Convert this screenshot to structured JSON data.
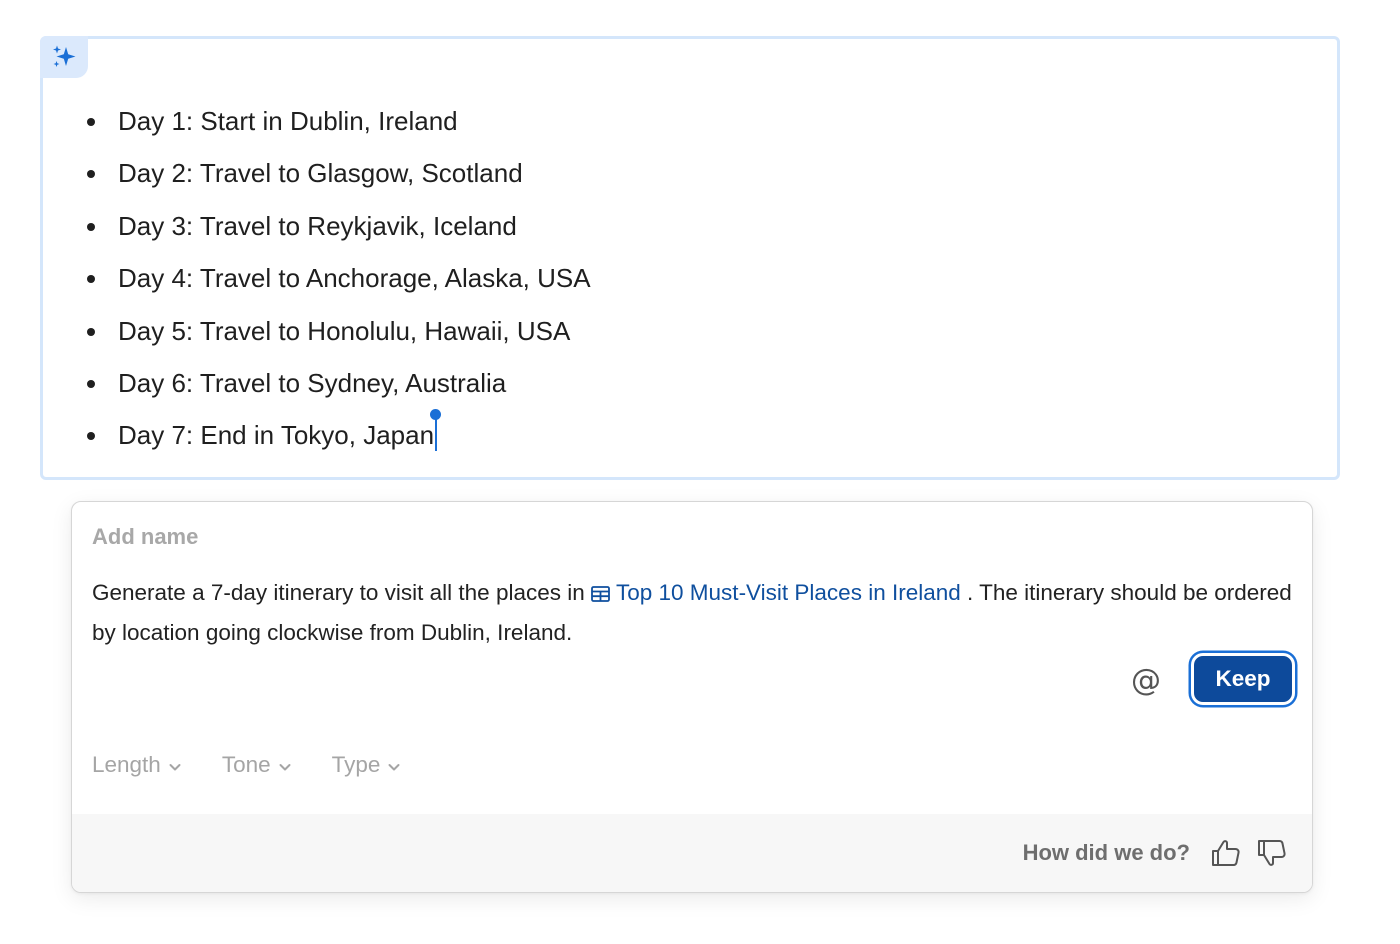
{
  "ai_block": {
    "icon": "sparkle-icon",
    "accent": "#1a6fd6",
    "items": [
      "Day 1: Start in Dublin, Ireland",
      "Day 2: Travel to Glasgow, Scotland",
      "Day 3: Travel to Reykjavik, Iceland",
      "Day 4: Travel to Anchorage, Alaska, USA",
      "Day 5: Travel to Honolulu, Hawaii, USA",
      "Day 6: Travel to Sydney, Australia",
      "Day 7: End in Tokyo, Japan"
    ]
  },
  "prompt": {
    "name_placeholder": "Add name",
    "text_before": "Generate a 7-day itinerary to visit all the places in ",
    "link_icon": "table-icon",
    "link_text": "Top 10 Must-Visit Places in Ireland",
    "text_after": " . The itinerary should be ordered by location going clockwise from Dublin, Ireland.",
    "mention_symbol": "@",
    "keep_label": "Keep",
    "keep_color": "#0d4a9b"
  },
  "options": {
    "length_label": "Length",
    "tone_label": "Tone",
    "type_label": "Type"
  },
  "feedback": {
    "label": "How did we do?",
    "thumbs_up_icon": "thumbs-up-icon",
    "thumbs_down_icon": "thumbs-down-icon"
  }
}
